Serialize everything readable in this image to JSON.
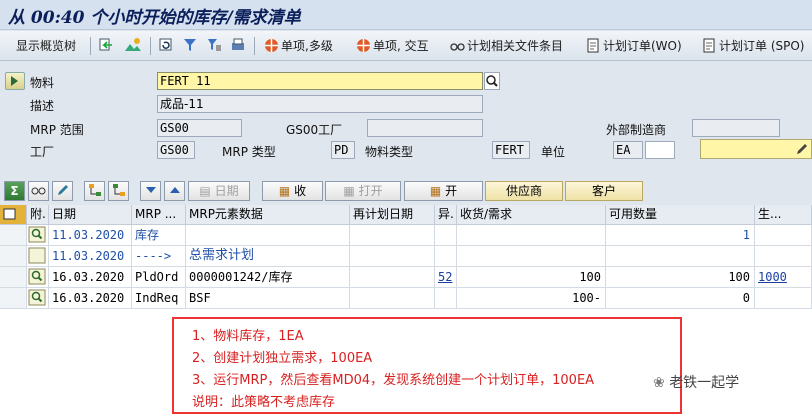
{
  "title": "从 00:40 个小时开始的库存/需求清单",
  "toolbar": {
    "show_overview_tree": "显示概览树",
    "single_multi": "单项,多级",
    "single_interactive": "单项, 交互",
    "plan_related_files": "计划相关文件条目",
    "plan_order_wo": "计划订单(WO)",
    "plan_order_spo": "计划订单 (SPO)"
  },
  "header": {
    "material_label": "物料",
    "material_value": "FERT 11",
    "description_label": "描述",
    "description_value": "成品-11",
    "mrp_area_label": "MRP 范围",
    "mrp_area_value": "GS00",
    "mrp_area_plant_label": "GS00工厂",
    "external_mfr_label": "外部制造商",
    "plant_label": "工厂",
    "plant_value": "GS00",
    "mrp_type_label": "MRP 类型",
    "mrp_type_value": "PD",
    "material_type_label": "物料类型",
    "material_type_value": "FERT",
    "unit_label": "单位",
    "unit_value": "EA"
  },
  "bar2": {
    "date": "日期",
    "collect": "收",
    "open": "打开",
    "open2": "开",
    "vendor": "供应商",
    "customer": "客户"
  },
  "grid": {
    "columns": [
      "附.",
      "日期",
      "MRP ...",
      "MRP元素数据",
      "再计划日期",
      "异.",
      "收货/需求",
      "可用数量",
      "生..."
    ],
    "rows": [
      {
        "date": "11.03.2020",
        "mrp": "库存",
        "data": "",
        "resched": "",
        "exc": "",
        "rcpt": "",
        "avail": "1",
        "prod": "",
        "blue": true
      },
      {
        "date": "11.03.2020",
        "mrp": "---->",
        "data": "总需求计划",
        "resched": "",
        "exc": "",
        "rcpt": "",
        "avail": "",
        "prod": "",
        "blue": true
      },
      {
        "date": "16.03.2020",
        "mrp": "PldOrd",
        "data": "0000001242/库存",
        "resched": "",
        "exc": "52",
        "rcpt": "100",
        "avail": "100",
        "prod": "1000",
        "blue": false
      },
      {
        "date": "16.03.2020",
        "mrp": "IndReq",
        "data": "BSF",
        "resched": "",
        "exc": "",
        "rcpt": "100-",
        "avail": "0",
        "prod": "",
        "blue": false
      }
    ]
  },
  "annotation": {
    "line1": "1、物料库存，1EA",
    "line2": "2、创建计划独立需求，100EA",
    "line3": "3、运行MRP，然后查看MD04，发现系统创建一个计划订单，100EA",
    "line4": "说明：此策略不考虑库存"
  },
  "watermark": "老铁一起学",
  "colors": {
    "accent_red": "#d92020",
    "link_blue": "#1f4fa8",
    "title_blue": "#0a1e5a"
  }
}
